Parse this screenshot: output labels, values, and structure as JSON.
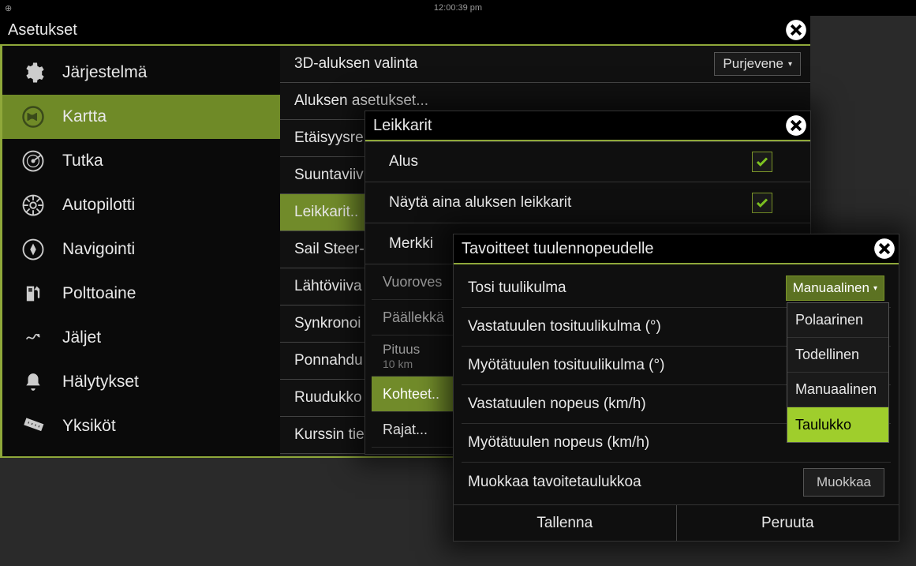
{
  "statusbar": {
    "time": "12:00:39 pm"
  },
  "settings": {
    "title": "Asetukset",
    "sidebar": [
      {
        "label": "Järjestelmä"
      },
      {
        "label": "Kartta"
      },
      {
        "label": "Tutka"
      },
      {
        "label": "Autopilotti"
      },
      {
        "label": "Navigointi"
      },
      {
        "label": "Polttoaine"
      },
      {
        "label": "Jäljet"
      },
      {
        "label": "Hälytykset"
      },
      {
        "label": "Yksiköt"
      }
    ],
    "content": {
      "row0": {
        "label": "3D-aluksen valinta",
        "value": "Purjevene"
      },
      "rows": [
        "Aluksen asetukset...",
        "Etäisyysren",
        "Suuntaviiv",
        "Leikkarit..",
        "Sail Steer-",
        "Lähtöviiva",
        "Synkronoi",
        "Ponnahdu",
        "Ruudukko",
        "Kurssin tie"
      ]
    }
  },
  "dialog1": {
    "title": "Leikkarit",
    "checks": [
      {
        "label": "Alus",
        "on": true
      },
      {
        "label": "Näytä aina aluksen leikkarit",
        "on": true
      },
      {
        "label": "Merkki"
      }
    ],
    "sub": {
      "vuoroves": "Vuoroves",
      "paallekka": "Päällekkä",
      "pituus": "Pituus",
      "pituus_val": "10 km",
      "kohteet": "Kohteet..",
      "rajat": "Rajat..."
    }
  },
  "dialog2": {
    "title": "Tavoitteet tuulennopeudelle",
    "rows": {
      "tosi": "Tosi tuulikulma",
      "tosi_val": "Manuaalinen",
      "vast_kulma": "Vastatuulen tosituulikulma (°)",
      "myot_kulma": "Myötätuulen tosituulikulma (°)",
      "vast_nop": "Vastatuulen nopeus (km/h)",
      "myot_nop": "Myötätuulen nopeus (km/h)",
      "muokkaa_row": "Muokkaa tavoitetaulukkoa",
      "muokkaa_btn": "Muokkaa"
    },
    "footer": {
      "save": "Tallenna",
      "cancel": "Peruuta"
    }
  },
  "menu": {
    "items": [
      "Polaarinen",
      "Todellinen",
      "Manuaalinen",
      "Taulukko"
    ]
  }
}
